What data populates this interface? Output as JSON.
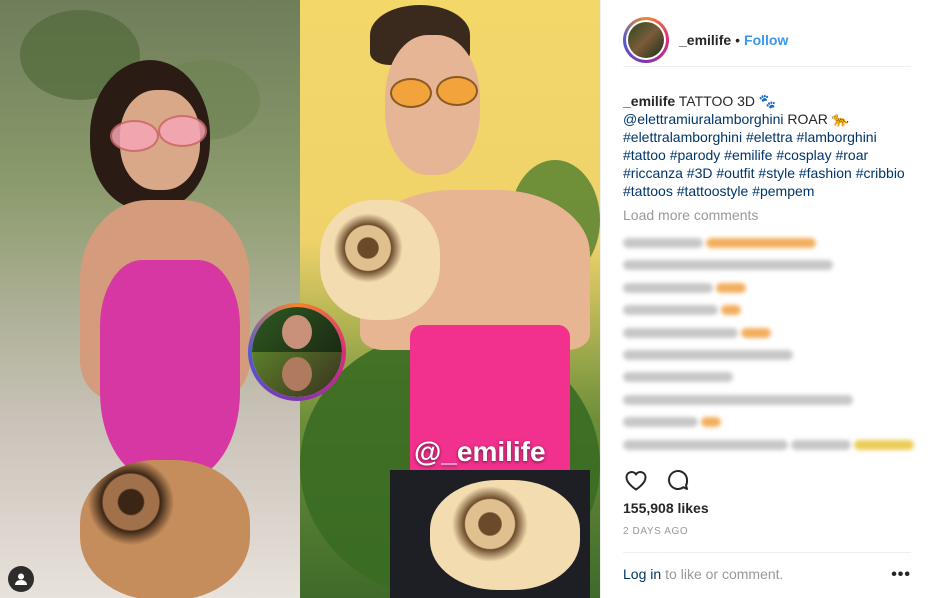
{
  "header": {
    "username": "_emilife",
    "separator": "•",
    "follow_label": "Follow"
  },
  "caption": {
    "author": "_emilife",
    "text": "TATTOO 3D 🐾",
    "mention": "@elettramiuralamborghini",
    "after_mention": "ROAR 🐆",
    "hashtags": "#elettralamborghini #elettra #lamborghini #tattoo #parody #emilife #cosplay #roar #riccanza #3D #outfit #style #fashion #cribbio #tattoos #tattoostyle #pempem"
  },
  "load_more_label": "Load more comments",
  "photo": {
    "watermark": "@_emilife"
  },
  "likes": "155,908 likes",
  "timestamp": "2 DAYS AGO",
  "footer": {
    "login_label": "Log in",
    "rest_label": "to like or comment.",
    "more_label": "•••"
  },
  "comment_widths": [
    [
      80,
      110
    ],
    [
      210
    ],
    [
      90,
      30
    ],
    [
      95,
      20
    ],
    [
      115,
      30
    ],
    [
      170
    ],
    [
      110
    ],
    [
      230
    ],
    [
      75,
      20
    ],
    [
      165,
      60,
      60
    ]
  ],
  "colors": {
    "link": "#003569",
    "follow": "#3897f0",
    "muted": "#999999",
    "ring_start": "#f58529",
    "ring_mid": "#dd2a7b"
  }
}
